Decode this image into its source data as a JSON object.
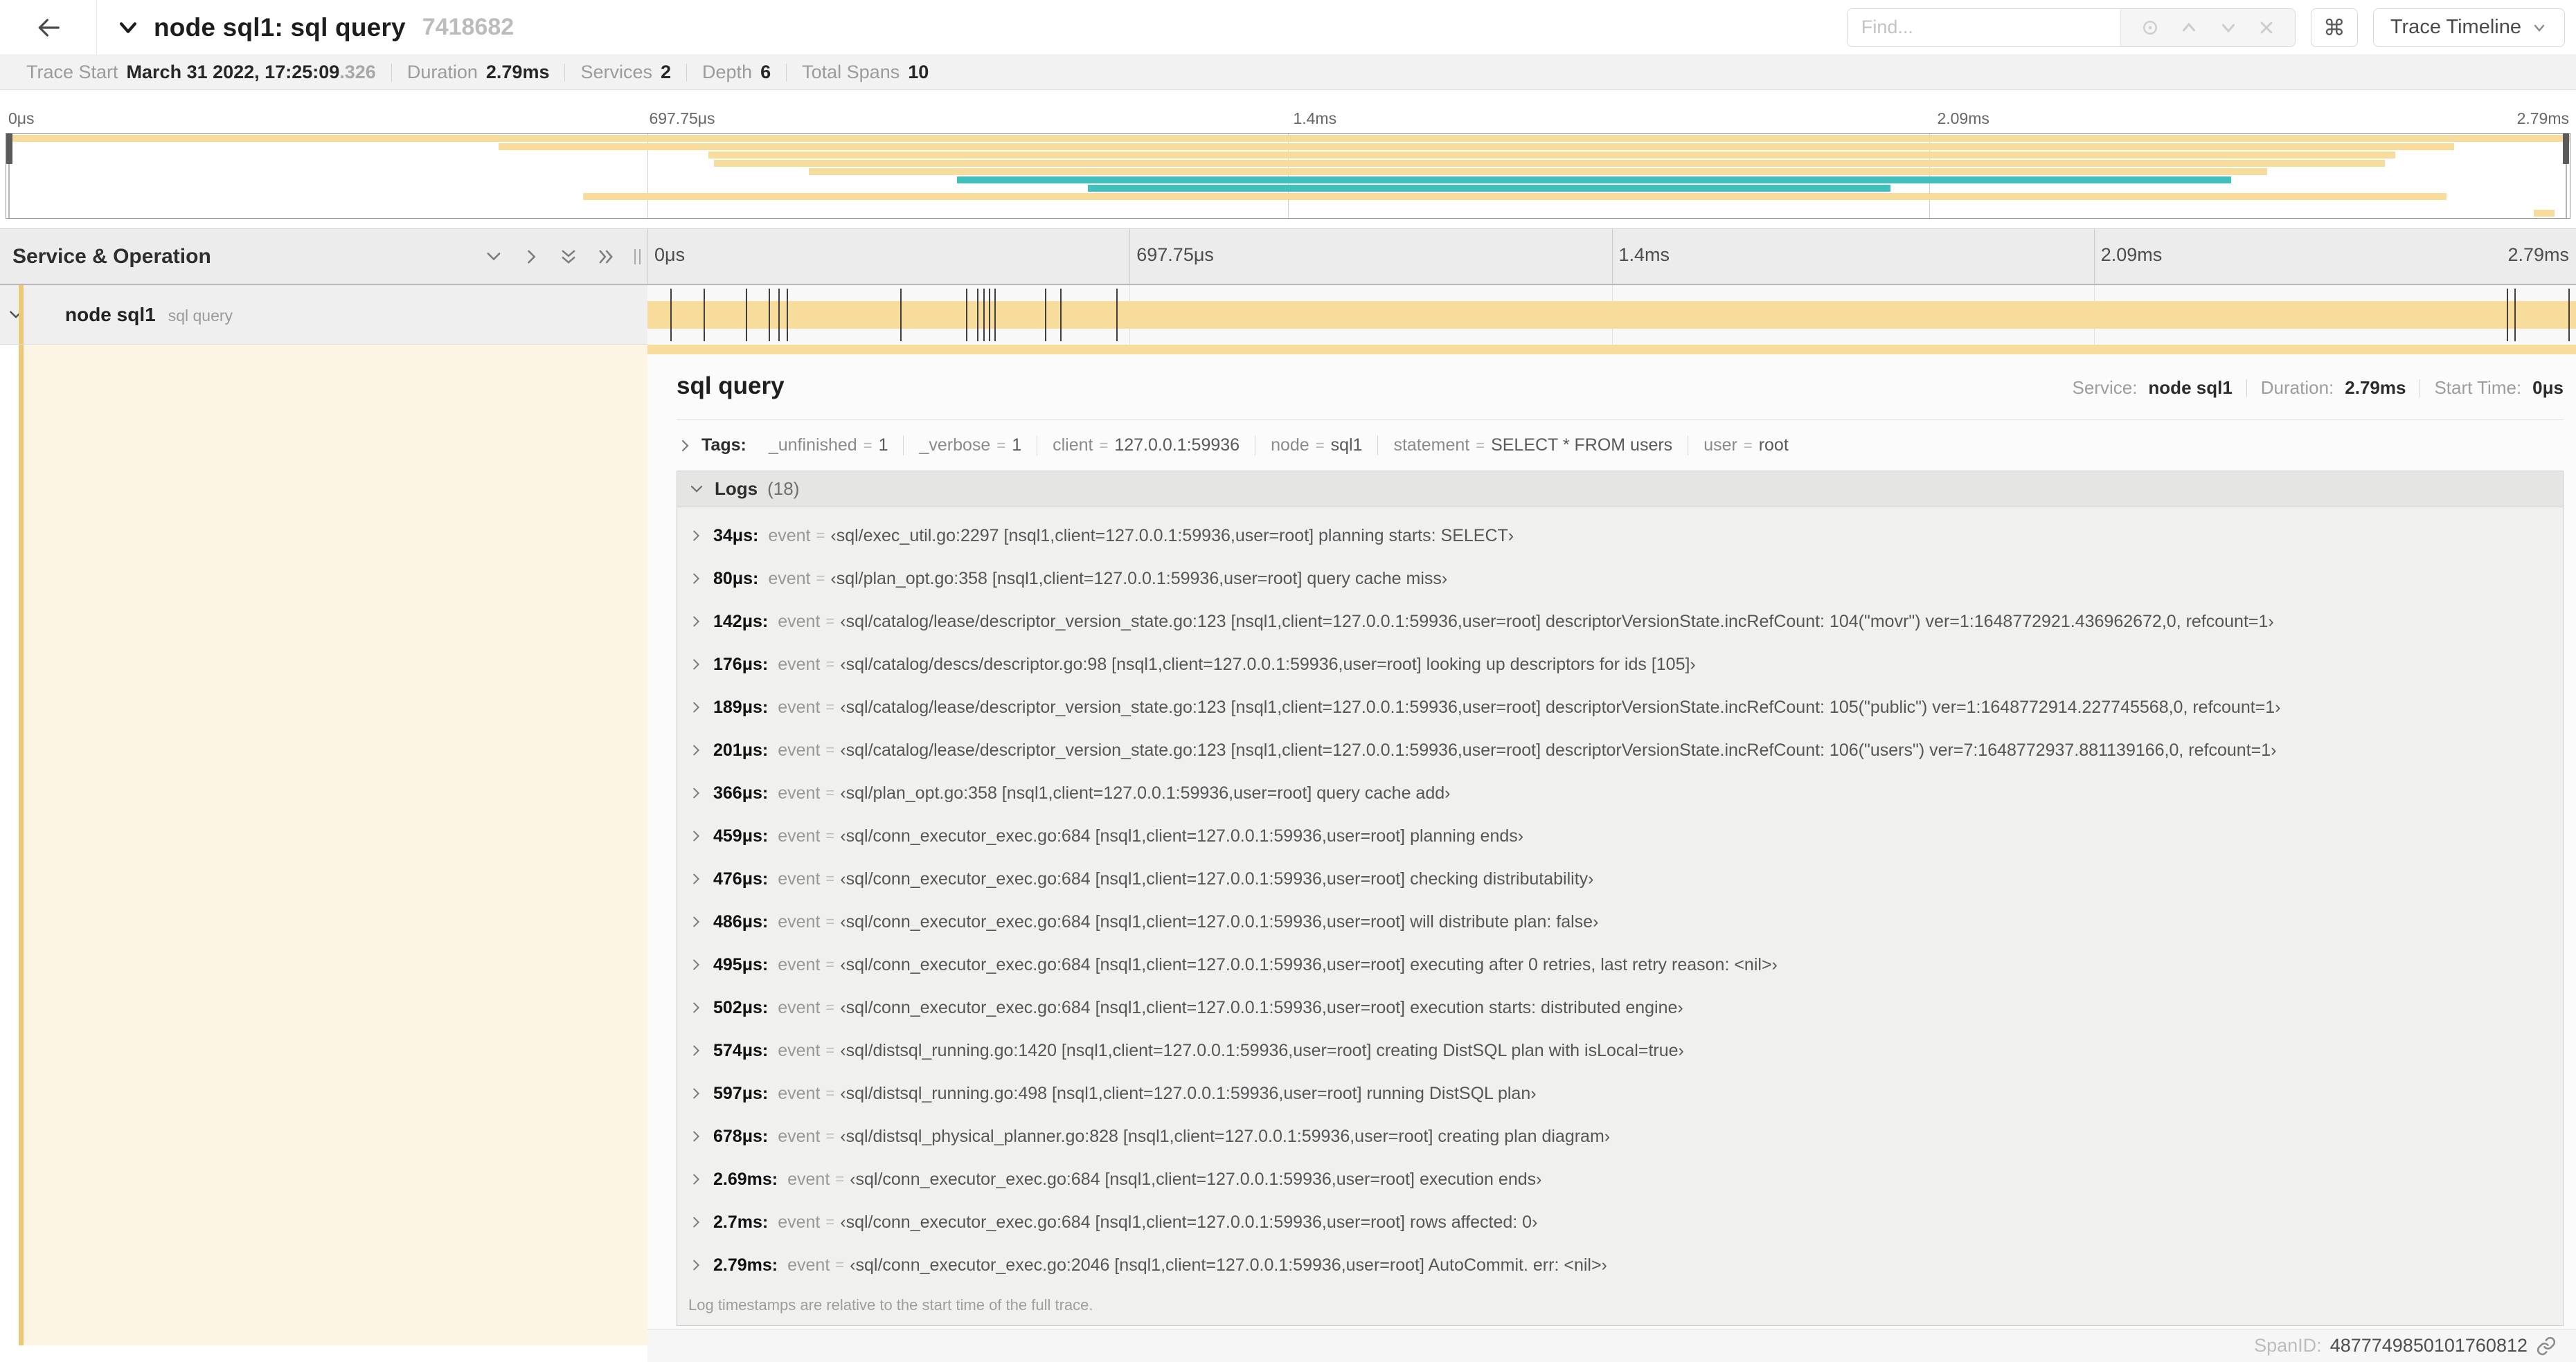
{
  "header": {
    "title": "node sql1: sql query",
    "trace_id": "7418682",
    "find_placeholder": "Find...",
    "kbd_glyph": "⌘",
    "view_mode": "Trace Timeline"
  },
  "meta": {
    "trace_start_label": "Trace Start",
    "trace_start_value": "March 31 2022, 17:25:09",
    "trace_start_fraction": ".326",
    "duration_label": "Duration",
    "duration_value": "2.79ms",
    "services_label": "Services",
    "services_value": "2",
    "depth_label": "Depth",
    "depth_value": "6",
    "total_spans_label": "Total Spans",
    "total_spans_value": "10"
  },
  "timeline": {
    "ticks": [
      "0μs",
      "697.75μs",
      "1.4ms",
      "2.09ms",
      "2.79ms"
    ],
    "service_operation_label": "Service & Operation"
  },
  "colors": {
    "span_tan": "#f7dc9b",
    "span_teal": "#3fc0bc",
    "row_strip_tan": "#ecc878",
    "detail_cream": "#fdf5e3"
  },
  "minimap": {
    "spans": [
      {
        "start_pct": 0,
        "end_pct": 100,
        "color": "tan"
      },
      {
        "start_pct": 19.2,
        "end_pct": 95.5,
        "color": "tan"
      },
      {
        "start_pct": 27.4,
        "end_pct": 93.2,
        "color": "tan"
      },
      {
        "start_pct": 27.6,
        "end_pct": 92.8,
        "color": "tan"
      },
      {
        "start_pct": 31.3,
        "end_pct": 88.2,
        "color": "tan"
      },
      {
        "start_pct": 37.1,
        "end_pct": 86.8,
        "color": "teal"
      },
      {
        "start_pct": 42.2,
        "end_pct": 73.5,
        "color": "teal"
      },
      {
        "start_pct": 22.5,
        "end_pct": 95.2,
        "color": "tan"
      },
      {
        "start_pct": 0,
        "end_pct": 0,
        "color": "none"
      },
      {
        "start_pct": 98.6,
        "end_pct": 99.4,
        "color": "tan"
      }
    ]
  },
  "span_row": {
    "service": "node sql1",
    "operation": "sql query",
    "bar_start_pct": 0,
    "bar_end_pct": 100,
    "log_tick_pcts": [
      1.2,
      2.9,
      5.1,
      6.3,
      6.8,
      7.2,
      13.1,
      16.5,
      17.1,
      17.4,
      17.7,
      18.0,
      20.6,
      21.4,
      24.3,
      96.4,
      96.8,
      99.6
    ]
  },
  "detail": {
    "title": "sql query",
    "service_label": "Service:",
    "service_value": "node sql1",
    "duration_label": "Duration:",
    "duration_value": "2.79ms",
    "start_time_label": "Start Time:",
    "start_time_value": "0μs",
    "tags_label": "Tags:",
    "tags": [
      {
        "key": "_unfinished",
        "value": "1"
      },
      {
        "key": "_verbose",
        "value": "1"
      },
      {
        "key": "client",
        "value": "127.0.0.1:59936"
      },
      {
        "key": "node",
        "value": "sql1"
      },
      {
        "key": "statement",
        "value": "SELECT * FROM users"
      },
      {
        "key": "user",
        "value": "root"
      }
    ],
    "logs_label": "Logs",
    "logs_count": "(18)",
    "event_key": "event",
    "equals_glyph": "=",
    "logs": [
      {
        "time": "34μs:",
        "message": "‹sql/exec_util.go:2297 [nsql1,client=127.0.0.1:59936,user=root] planning starts: SELECT›"
      },
      {
        "time": "80μs:",
        "message": "‹sql/plan_opt.go:358 [nsql1,client=127.0.0.1:59936,user=root] query cache miss›"
      },
      {
        "time": "142μs:",
        "message": "‹sql/catalog/lease/descriptor_version_state.go:123 [nsql1,client=127.0.0.1:59936,user=root] descriptorVersionState.incRefCount: 104(\"movr\") ver=1:1648772921.436962672,0, refcount=1›"
      },
      {
        "time": "176μs:",
        "message": "‹sql/catalog/descs/descriptor.go:98 [nsql1,client=127.0.0.1:59936,user=root] looking up descriptors for ids [105]›"
      },
      {
        "time": "189μs:",
        "message": "‹sql/catalog/lease/descriptor_version_state.go:123 [nsql1,client=127.0.0.1:59936,user=root] descriptorVersionState.incRefCount: 105(\"public\") ver=1:1648772914.227745568,0, refcount=1›"
      },
      {
        "time": "201μs:",
        "message": "‹sql/catalog/lease/descriptor_version_state.go:123 [nsql1,client=127.0.0.1:59936,user=root] descriptorVersionState.incRefCount: 106(\"users\") ver=7:1648772937.881139166,0, refcount=1›"
      },
      {
        "time": "366μs:",
        "message": "‹sql/plan_opt.go:358 [nsql1,client=127.0.0.1:59936,user=root] query cache add›"
      },
      {
        "time": "459μs:",
        "message": "‹sql/conn_executor_exec.go:684 [nsql1,client=127.0.0.1:59936,user=root] planning ends›"
      },
      {
        "time": "476μs:",
        "message": "‹sql/conn_executor_exec.go:684 [nsql1,client=127.0.0.1:59936,user=root] checking distributability›"
      },
      {
        "time": "486μs:",
        "message": "‹sql/conn_executor_exec.go:684 [nsql1,client=127.0.0.1:59936,user=root] will distribute plan: false›"
      },
      {
        "time": "495μs:",
        "message": "‹sql/conn_executor_exec.go:684 [nsql1,client=127.0.0.1:59936,user=root] executing after 0 retries, last retry reason: <nil>›"
      },
      {
        "time": "502μs:",
        "message": "‹sql/conn_executor_exec.go:684 [nsql1,client=127.0.0.1:59936,user=root] execution starts: distributed engine›"
      },
      {
        "time": "574μs:",
        "message": "‹sql/distsql_running.go:1420 [nsql1,client=127.0.0.1:59936,user=root] creating DistSQL plan with isLocal=true›"
      },
      {
        "time": "597μs:",
        "message": "‹sql/distsql_running.go:498 [nsql1,client=127.0.0.1:59936,user=root] running DistSQL plan›"
      },
      {
        "time": "678μs:",
        "message": "‹sql/distsql_physical_planner.go:828 [nsql1,client=127.0.0.1:59936,user=root] creating plan diagram›"
      },
      {
        "time": "2.69ms:",
        "message": "‹sql/conn_executor_exec.go:684 [nsql1,client=127.0.0.1:59936,user=root] execution ends›"
      },
      {
        "time": "2.7ms:",
        "message": "‹sql/conn_executor_exec.go:684 [nsql1,client=127.0.0.1:59936,user=root] rows affected: 0›"
      },
      {
        "time": "2.79ms:",
        "message": "‹sql/conn_executor_exec.go:2046 [nsql1,client=127.0.0.1:59936,user=root] AutoCommit. err: <nil>›"
      }
    ],
    "logs_footer": "Log timestamps are relative to the start time of the full trace.",
    "spanid_label": "SpanID:",
    "spanid_value": "4877749850101760812"
  }
}
